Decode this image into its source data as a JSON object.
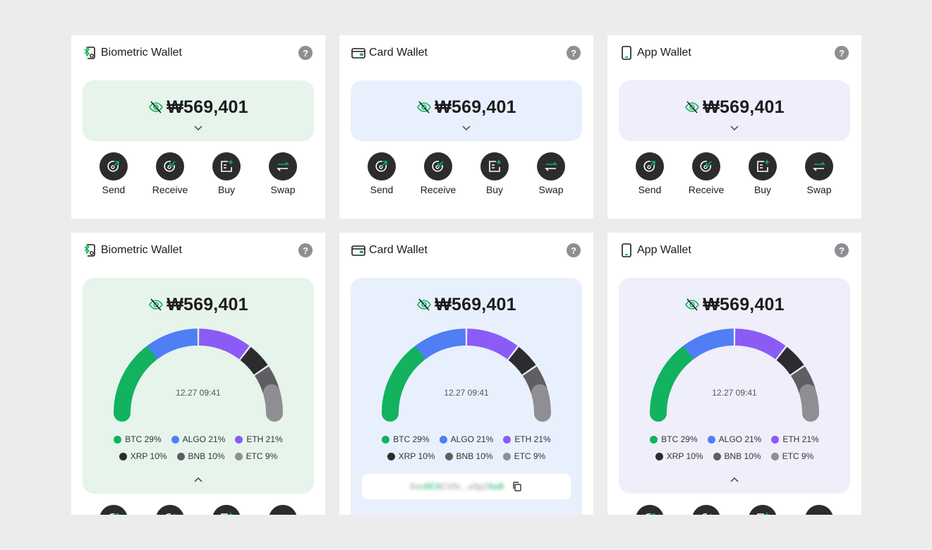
{
  "colors": {
    "background": "#ececec",
    "card": "#ffffff",
    "panel_green": "#e6f4ec",
    "panel_blue": "#e9f0fd",
    "panel_purple": "#efeefb",
    "btc": "#12b25f",
    "algo": "#4f7ef5",
    "eth": "#8a5cf5",
    "xrp": "#2c2c2e",
    "bnb": "#5e5e63",
    "etc": "#8e8e93"
  },
  "wallets": {
    "biometric": {
      "title": "Biometric Wallet",
      "icon": "biometric-wallet-icon"
    },
    "card": {
      "title": "Card Wallet",
      "icon": "card-wallet-icon"
    },
    "app": {
      "title": "App Wallet",
      "icon": "phone-wallet-icon"
    }
  },
  "help_label": "?",
  "balance": "₩569,401",
  "timestamp": "12.27 09:41",
  "actions": {
    "send": "Send",
    "receive": "Receive",
    "buy": "Buy",
    "swap": "Swap"
  },
  "legend": {
    "btc": "BTC 29%",
    "algo": "ALGO 21%",
    "eth": "ETH 21%",
    "xrp": "XRP 10%",
    "bnb": "BNB 10%",
    "etc": "ETC 9%"
  },
  "chart_data": {
    "type": "pie",
    "categories": [
      "BTC",
      "ALGO",
      "ETH",
      "XRP",
      "BNB",
      "ETC"
    ],
    "values": [
      29,
      21,
      21,
      10,
      10,
      9
    ],
    "title": "",
    "style": "semi-donut gauge"
  },
  "address": {
    "part1": "0x",
    "part2": "c8E9",
    "part3": "CVfs...x0p2",
    "part4": "9aB"
  }
}
